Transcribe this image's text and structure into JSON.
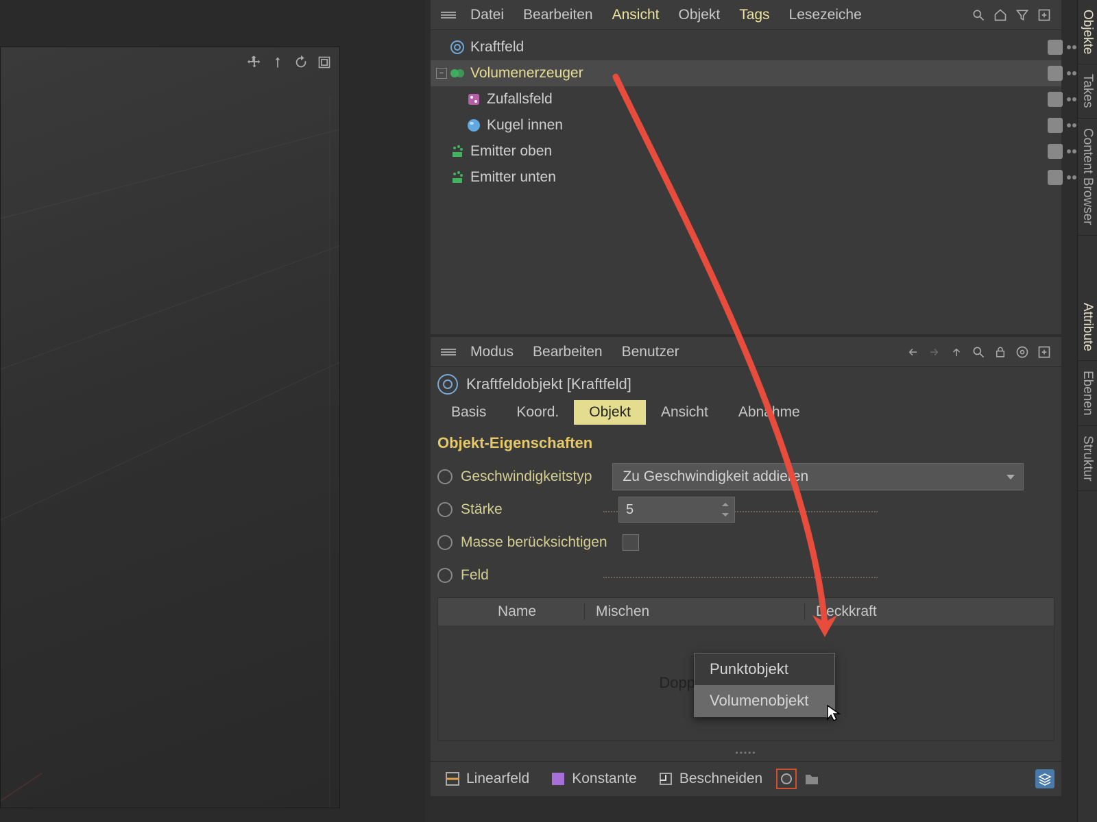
{
  "objmenu": {
    "datei": "Datei",
    "bearbeiten": "Bearbeiten",
    "ansicht": "Ansicht",
    "objekt": "Objekt",
    "tags": "Tags",
    "lesezeiche": "Lesezeiche"
  },
  "tree": {
    "kraftfeld": "Kraftfeld",
    "volumenerzeuger": "Volumenerzeuger",
    "zufallsfeld": "Zufallsfeld",
    "kugel": "Kugel innen",
    "emitter_oben": "Emitter oben",
    "emitter_unten": "Emitter unten"
  },
  "attrmenu": {
    "modus": "Modus",
    "bearbeiten": "Bearbeiten",
    "benutzer": "Benutzer"
  },
  "attr_title": "Kraftfeldobjekt [Kraftfeld]",
  "tabs": {
    "basis": "Basis",
    "koord": "Koord.",
    "objekt": "Objekt",
    "ansicht": "Ansicht",
    "abnahme": "Abnahme"
  },
  "section": "Objekt-Eigenschaften",
  "props": {
    "velocity_label": "Geschwindigkeitstyp",
    "velocity_value": "Zu Geschwindigkeit addieren",
    "strength_label": "Stärke",
    "strength_value": "5",
    "mass_label": "Masse berücksichtigen",
    "field_label": "Feld",
    "th_name": "Name",
    "th_mix": "Mischen",
    "th_opacity": "Deckkraft",
    "hint": "Doppelklick, um                         erzeugen"
  },
  "ctx": {
    "punkt": "Punktobjekt",
    "volumen": "Volumenobjekt"
  },
  "bottom": {
    "linear": "Linearfeld",
    "konst": "Konstante",
    "beschn": "Beschneiden"
  },
  "sidetabs": {
    "objekte": "Objekte",
    "takes": "Takes",
    "content": "Content Browser",
    "attribute": "Attribute",
    "ebenen": "Ebenen",
    "struktur": "Struktur"
  }
}
